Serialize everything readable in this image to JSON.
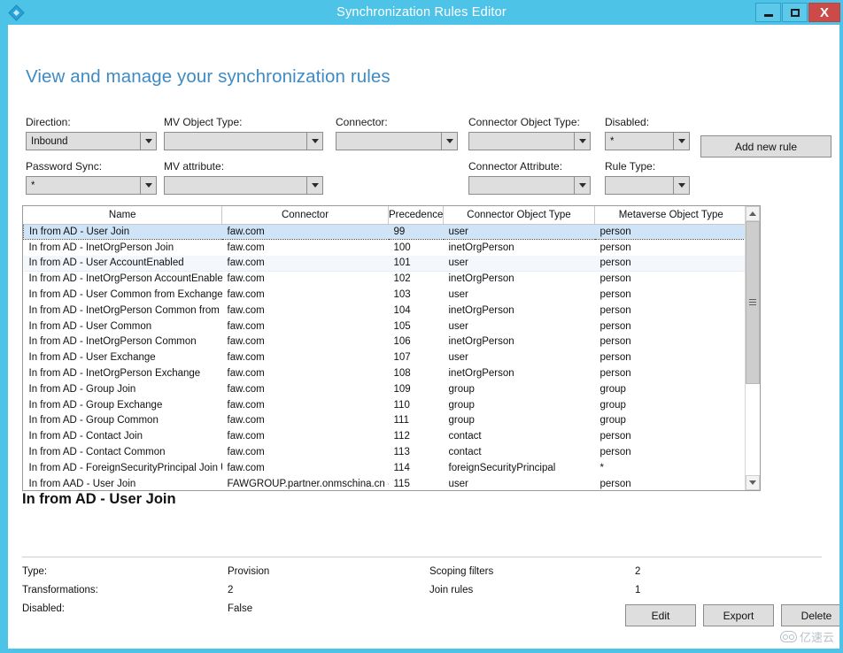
{
  "window": {
    "title": "Synchronization Rules Editor",
    "app_icon": "diamond-icon",
    "minimize_label": "",
    "maximize_label": "",
    "close_label": "X",
    "accent_color": "#4ec3e8"
  },
  "page": {
    "heading": "View and manage your synchronization rules",
    "heading_color": "#3e8bc4"
  },
  "filters": {
    "direction": {
      "label": "Direction:",
      "value": "Inbound"
    },
    "mv_object_type": {
      "label": "MV Object Type:",
      "value": ""
    },
    "connector": {
      "label": "Connector:",
      "value": ""
    },
    "connector_object_type": {
      "label": "Connector Object Type:",
      "value": ""
    },
    "disabled": {
      "label": "Disabled:",
      "value": "*"
    },
    "password_sync": {
      "label": "Password Sync:",
      "value": "*"
    },
    "mv_attribute": {
      "label": "MV attribute:",
      "value": ""
    },
    "connector_attribute": {
      "label": "Connector Attribute:",
      "value": ""
    },
    "rule_type": {
      "label": "Rule Type:",
      "value": ""
    },
    "add_new_rule": "Add new rule"
  },
  "grid": {
    "columns": [
      "Name",
      "Connector",
      "Precedence",
      "Connector Object Type",
      "Metaverse Object Type"
    ],
    "rows": [
      {
        "name": "In from AD - User Join",
        "connector": "faw.com",
        "precedence": "99",
        "cot": "user",
        "mot": "person",
        "state": "selected"
      },
      {
        "name": "In from AD - InetOrgPerson Join",
        "connector": "faw.com",
        "precedence": "100",
        "cot": "inetOrgPerson",
        "mot": "person",
        "state": "normal"
      },
      {
        "name": "In from AD - User AccountEnabled",
        "connector": "faw.com",
        "precedence": "101",
        "cot": "user",
        "mot": "person",
        "state": "alt"
      },
      {
        "name": "In from AD - InetOrgPerson AccountEnabled",
        "connector": "faw.com",
        "precedence": "102",
        "cot": "inetOrgPerson",
        "mot": "person",
        "state": "normal"
      },
      {
        "name": "In from AD - User Common from Exchange",
        "connector": "faw.com",
        "precedence": "103",
        "cot": "user",
        "mot": "person",
        "state": "normal"
      },
      {
        "name": "In from AD - InetOrgPerson Common from E:",
        "connector": "faw.com",
        "precedence": "104",
        "cot": "inetOrgPerson",
        "mot": "person",
        "state": "normal"
      },
      {
        "name": "In from AD - User Common",
        "connector": "faw.com",
        "precedence": "105",
        "cot": "user",
        "mot": "person",
        "state": "normal"
      },
      {
        "name": "In from AD - InetOrgPerson Common",
        "connector": "faw.com",
        "precedence": "106",
        "cot": "inetOrgPerson",
        "mot": "person",
        "state": "normal"
      },
      {
        "name": "In from AD - User Exchange",
        "connector": "faw.com",
        "precedence": "107",
        "cot": "user",
        "mot": "person",
        "state": "normal"
      },
      {
        "name": "In from AD - InetOrgPerson Exchange",
        "connector": "faw.com",
        "precedence": "108",
        "cot": "inetOrgPerson",
        "mot": "person",
        "state": "normal"
      },
      {
        "name": "In from AD - Group Join",
        "connector": "faw.com",
        "precedence": "109",
        "cot": "group",
        "mot": "group",
        "state": "normal"
      },
      {
        "name": "In from AD - Group Exchange",
        "connector": "faw.com",
        "precedence": "110",
        "cot": "group",
        "mot": "group",
        "state": "normal"
      },
      {
        "name": "In from AD - Group Common",
        "connector": "faw.com",
        "precedence": "111",
        "cot": "group",
        "mot": "group",
        "state": "normal"
      },
      {
        "name": "In from AD - Contact Join",
        "connector": "faw.com",
        "precedence": "112",
        "cot": "contact",
        "mot": "person",
        "state": "normal"
      },
      {
        "name": "In from AD - Contact Common",
        "connector": "faw.com",
        "precedence": "113",
        "cot": "contact",
        "mot": "person",
        "state": "normal"
      },
      {
        "name": "In from AD - ForeignSecurityPrincipal Join Us",
        "connector": "faw.com",
        "precedence": "114",
        "cot": "foreignSecurityPrincipal",
        "mot": "*",
        "state": "normal"
      },
      {
        "name": "In from AAD - User Join",
        "connector": "FAWGROUP.partner.onmschina.cn - A/",
        "precedence": "115",
        "cot": "user",
        "mot": "person",
        "state": "normal"
      }
    ]
  },
  "detail": {
    "rule_name": "In from AD - User Join",
    "left": [
      {
        "key": "Type:",
        "value": "Provision"
      },
      {
        "key": "Transformations:",
        "value": "2"
      },
      {
        "key": "Disabled:",
        "value": "False"
      }
    ],
    "right": [
      {
        "key": "Scoping filters",
        "value": "2"
      },
      {
        "key": "Join rules",
        "value": "1"
      }
    ]
  },
  "actions": {
    "edit": "Edit",
    "export": "Export",
    "delete": "Delete"
  },
  "watermark": {
    "text": "亿速云"
  }
}
